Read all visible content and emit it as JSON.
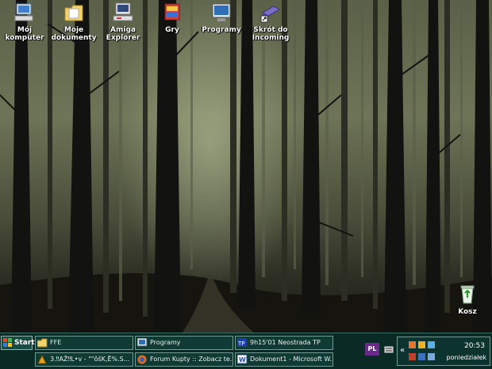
{
  "desktop": {
    "icons": [
      {
        "label_lines": [
          "Mój komputer"
        ],
        "icon": "my-computer-icon"
      },
      {
        "label_lines": [
          "Moje",
          "dokumenty"
        ],
        "icon": "my-documents-icon"
      },
      {
        "label_lines": [
          "Amiga",
          "Explorer"
        ],
        "icon": "amiga-explorer-icon"
      },
      {
        "label_lines": [
          "Gry"
        ],
        "icon": "games-folder-icon"
      },
      {
        "label_lines": [
          "Programy"
        ],
        "icon": "programs-icon"
      },
      {
        "label_lines": [
          "Skrót do",
          "Incoming"
        ],
        "icon": "shortcut-incoming-icon"
      },
      {
        "label_lines": [
          "Kosz"
        ],
        "icon": "recycle-bin-icon"
      }
    ]
  },
  "taskbar": {
    "start_label": "Start",
    "buttons": [
      {
        "label": "FFE",
        "icon": "folder-icon"
      },
      {
        "label": "Programy",
        "icon": "window-icon"
      },
      {
        "label": "9h15'01 Neostrada TP",
        "icon": "tp-icon"
      },
      {
        "label": "3.‼AŽ‼L•v - \"\"ôšK‚Ē%.S...",
        "icon": "app-icon"
      },
      {
        "label": "Forum Kupty :: Zobacz te...",
        "icon": "firefox-icon"
      },
      {
        "label": "Dokument1 - Microsoft W...",
        "icon": "word-icon"
      }
    ],
    "language": "PL",
    "tray": {
      "chevron": "«",
      "time": "20:53",
      "day": "poniedziałek"
    }
  },
  "colors": {
    "taskbar_bg": "#0a2a26",
    "button_border": "#6f9f94",
    "label_text": "#ffffff"
  }
}
